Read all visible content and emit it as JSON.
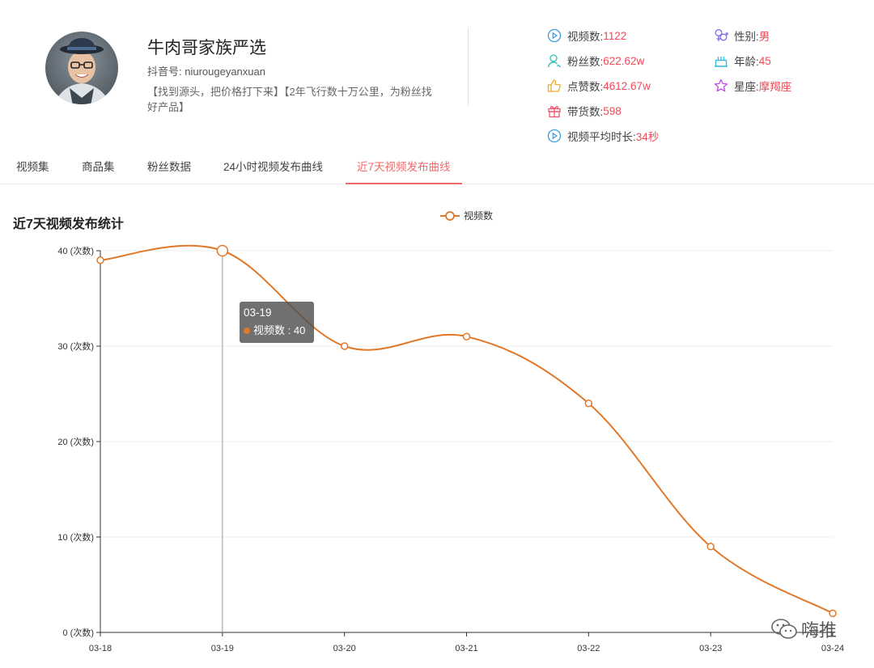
{
  "profile": {
    "name": "牛肉哥家族严选",
    "handle_label": "抖音号: ",
    "handle": "niurougeyanxuan",
    "bio": "【找到源头，把价格打下来】【2年飞行数十万公里，为粉丝找好产品】"
  },
  "stats": [
    {
      "icon": "play-circle-icon",
      "label": "视频数: ",
      "value": "1122"
    },
    {
      "icon": "user-icon",
      "label": "粉丝数: ",
      "value": "622.62w"
    },
    {
      "icon": "thumbs-up-icon",
      "label": "点赞数: ",
      "value": "4612.67w"
    },
    {
      "icon": "gift-icon",
      "label": "带货数: ",
      "value": "598"
    },
    {
      "icon": "play-circle-icon",
      "label": "视频平均时长: ",
      "value": "34秒"
    },
    {
      "icon": "gender-icon",
      "label": "性别: ",
      "value": "男"
    },
    {
      "icon": "cake-icon",
      "label": "年龄: ",
      "value": "45"
    },
    {
      "icon": "star-icon",
      "label": "星座: ",
      "value": "摩羯座"
    }
  ],
  "tabs": [
    {
      "label": "视频集",
      "active": false
    },
    {
      "label": "商品集",
      "active": false
    },
    {
      "label": "粉丝数据",
      "active": false
    },
    {
      "label": "24小时视频发布曲线",
      "active": false
    },
    {
      "label": "近7天视频发布曲线",
      "active": true
    }
  ],
  "section_title": "近7天视频发布统计",
  "chart_data": {
    "type": "line",
    "categories": [
      "03-18",
      "03-19",
      "03-20",
      "03-21",
      "03-22",
      "03-23",
      "03-24"
    ],
    "series": [
      {
        "name": "视频数",
        "values": [
          39,
          40,
          30,
          31,
          24,
          9,
          2
        ],
        "color": "#e0782a"
      }
    ],
    "y_ticks": [
      0,
      10,
      20,
      30,
      40
    ],
    "y_unit": "(次数)",
    "ylim": [
      0,
      40
    ],
    "grid": true,
    "legend": "top-center",
    "smooth": true
  },
  "tooltip": {
    "date": "03-19",
    "series": "视频数",
    "value": "40"
  },
  "watermark": {
    "text": "嗨推"
  }
}
